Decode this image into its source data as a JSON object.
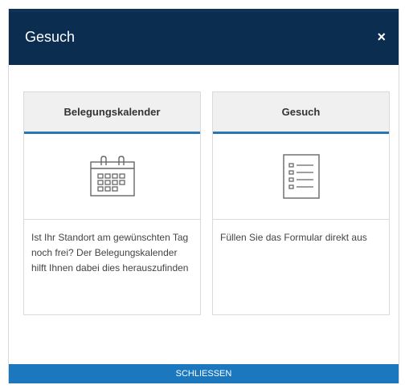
{
  "modal": {
    "title": "Gesuch",
    "close_label": "×",
    "footer_button": "SCHLIESSEN"
  },
  "cards": [
    {
      "title": "Belegungskalender",
      "icon": "calendar-icon",
      "text": "Ist Ihr Standort am gewünschten Tag noch frei? Der Belegungskalender hilft Ihnen dabei dies herauszufinden"
    },
    {
      "title": "Gesuch",
      "icon": "form-list-icon",
      "text": "Füllen Sie das Formular direkt aus"
    }
  ],
  "colors": {
    "header_bg": "#0b2d4f",
    "accent": "#2777b4",
    "footer_bg": "#1b78bf",
    "card_header_bg": "#f0f0f0"
  }
}
